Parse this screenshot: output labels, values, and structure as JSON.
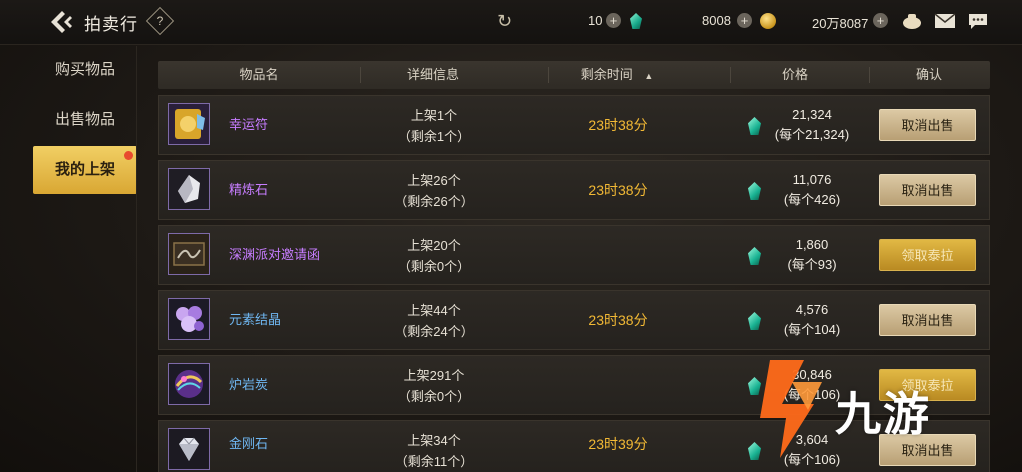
{
  "header": {
    "title": "拍卖行",
    "help_label": "?",
    "currencies": [
      {
        "value": "10",
        "icon": "teal-gem-icon"
      },
      {
        "value": "8008",
        "icon": "gold-coin-icon"
      },
      {
        "value": "20万8087",
        "icon": "money-bag-icon"
      }
    ]
  },
  "sidebar": {
    "items": [
      {
        "label": "购买物品",
        "active": false
      },
      {
        "label": "出售物品",
        "active": false
      },
      {
        "label": "我的上架",
        "active": true,
        "badge": true
      }
    ]
  },
  "table": {
    "columns": [
      "物品名",
      "详细信息",
      "剩余时间",
      "价格",
      "确认"
    ],
    "sort_indicator": "▲",
    "rows": [
      {
        "name": "幸运符",
        "name_color": "purple",
        "icon": "lucky-charm-icon",
        "detail_listed": "上架1个",
        "detail_remaining": "（剩余1个）",
        "time": "23时38分",
        "price": "21,324",
        "unit_price": "(每个21,324)",
        "action": "取消出售"
      },
      {
        "name": "精炼石",
        "name_color": "purple",
        "icon": "refining-stone-icon",
        "detail_listed": "上架26个",
        "detail_remaining": "（剩余26个）",
        "time": "23时38分",
        "price": "11,076",
        "unit_price": "(每个426)",
        "action": "取消出售"
      },
      {
        "name": "深渊派对邀请函",
        "name_color": "purple",
        "icon": "invitation-letter-icon",
        "detail_listed": "上架20个",
        "detail_remaining": "（剩余0个）",
        "time": "",
        "price": "1,860",
        "unit_price": "(每个93)",
        "action": "领取泰拉"
      },
      {
        "name": "元素结晶",
        "name_color": "blue",
        "icon": "element-crystal-icon",
        "detail_listed": "上架44个",
        "detail_remaining": "（剩余24个）",
        "time": "23时38分",
        "price": "4,576",
        "unit_price": "(每个104)",
        "action": "取消出售"
      },
      {
        "name": "炉岩炭",
        "name_color": "blue",
        "icon": "furnace-coal-icon",
        "detail_listed": "上架291个",
        "detail_remaining": "（剩余0个）",
        "time": "",
        "price": "30,846",
        "unit_price": "(每个106)",
        "action": "领取泰拉"
      },
      {
        "name": "金刚石",
        "name_color": "blue",
        "icon": "diamond-icon",
        "detail_listed": "上架34个",
        "detail_remaining": "（剩余11个）",
        "time": "23时39分",
        "price": "3,604",
        "unit_price": "(每个106)",
        "action": "取消出售"
      }
    ]
  },
  "watermark": {
    "text": "九游"
  },
  "colors": {
    "accent_gold": "#f2b935",
    "purple_name": "#c77dff",
    "blue_name": "#6fb7f2"
  }
}
